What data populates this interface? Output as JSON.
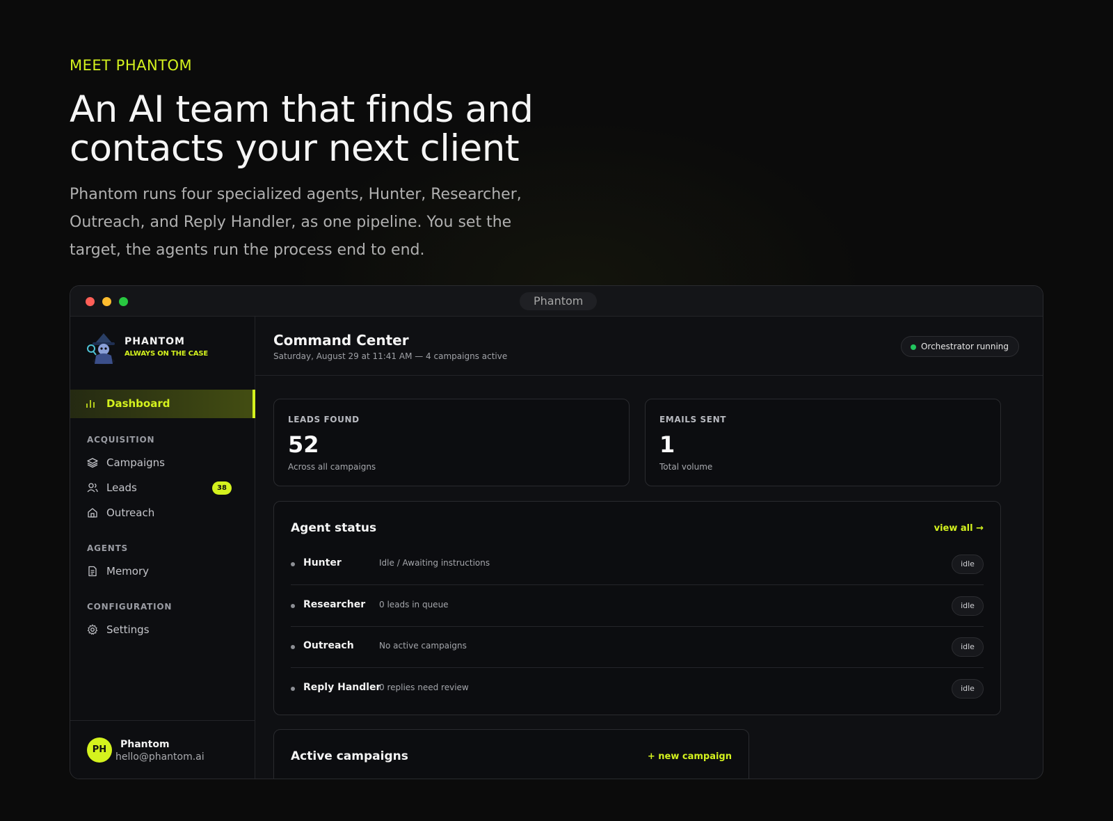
{
  "hero": {
    "eyebrow": "MEET PHANTOM",
    "headline_line1": "An AI team that finds and",
    "headline_line2": "contacts your next client",
    "subtext": "Phantom runs four specialized agents, Hunter, Researcher, Outreach, and Reply Handler, as one pipeline. You set the target, the agents run the process end to end."
  },
  "window": {
    "title": "Phantom"
  },
  "sidebar": {
    "brand_name": "PHANTOM",
    "brand_tagline": "ALWAYS ON THE CASE",
    "active_item": {
      "label": "Dashboard",
      "icon": "bar-chart-icon"
    },
    "sections": [
      {
        "label": "ACQUISITION",
        "items": [
          {
            "label": "Campaigns",
            "icon": "layers-icon"
          },
          {
            "label": "Leads",
            "icon": "users-icon",
            "badge": "38"
          },
          {
            "label": "Outreach",
            "icon": "home-icon"
          }
        ]
      },
      {
        "label": "AGENTS",
        "items": [
          {
            "label": "Memory",
            "icon": "document-icon"
          }
        ]
      },
      {
        "label": "CONFIGURATION",
        "items": [
          {
            "label": "Settings",
            "icon": "gear-icon"
          }
        ]
      }
    ],
    "user": {
      "initials": "PH",
      "name": "Phantom",
      "email": "hello@phantom.ai"
    }
  },
  "main": {
    "title": "Command Center",
    "subtitle": "Saturday, August 29 at 11:41 AM — 4 campaigns active",
    "status": "Orchestrator running",
    "stats": [
      {
        "label": "LEADS FOUND",
        "value": "52",
        "sub": "Across all campaigns"
      },
      {
        "label": "EMAILS SENT",
        "value": "1",
        "sub": "Total volume"
      }
    ],
    "agent_status": {
      "title": "Agent status",
      "link": "view all →",
      "agents": [
        {
          "name": "Hunter",
          "desc": "Idle / Awaiting instructions",
          "state": "idle"
        },
        {
          "name": "Researcher",
          "desc": "0 leads in queue",
          "state": "idle"
        },
        {
          "name": "Outreach",
          "desc": "No active campaigns",
          "state": "idle"
        },
        {
          "name": "Reply Handler",
          "desc": "0 replies need review",
          "state": "idle"
        }
      ]
    },
    "campaigns": {
      "title": "Active campaigns",
      "link": "+ new campaign"
    }
  },
  "colors": {
    "accent": "#d4f21e",
    "background": "#0b0b0b",
    "status_green": "#22c55e"
  }
}
